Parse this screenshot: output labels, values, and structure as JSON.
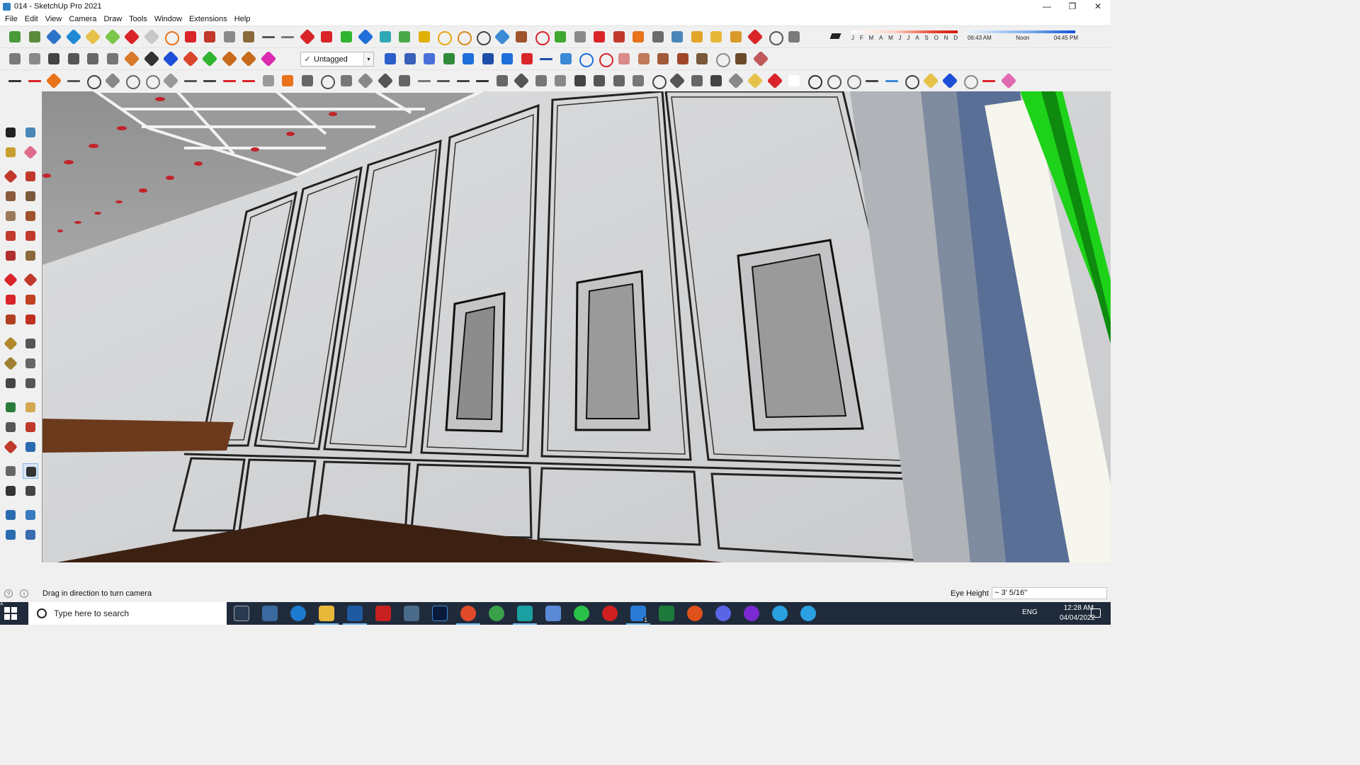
{
  "window": {
    "title": "014 - SketchUp Pro 2021",
    "minimize": "—",
    "maximize": "❐",
    "close": "✕"
  },
  "menu": [
    "File",
    "Edit",
    "View",
    "Camera",
    "Draw",
    "Tools",
    "Window",
    "Extensions",
    "Help"
  ],
  "toolbar": {
    "tag_dropdown": {
      "check": "✓",
      "value": "Untagged",
      "arrow": "▾"
    },
    "shadows": {
      "months": [
        "J",
        "F",
        "M",
        "A",
        "M",
        "J",
        "J",
        "A",
        "S",
        "O",
        "N",
        "D"
      ],
      "times": [
        "06:43 AM",
        "Noon",
        "04:45 PM"
      ]
    }
  },
  "status": {
    "hint": "Drag in direction to turn camera",
    "info_icons": [
      "?",
      "i"
    ],
    "vcb_label": "Eye Height",
    "vcb_value": "~ 3' 5/16\""
  },
  "taskbar": {
    "search_placeholder": "Type here to search",
    "language": "ENG",
    "time": "12:28 AM",
    "date": "04/04/2022",
    "badge": "1"
  },
  "colors": {
    "accent_orange": "#e8731a",
    "accent_red": "#d9252a",
    "accent_green": "#2fb530",
    "accent_blue": "#1e6fd9",
    "wall": "#d5d6d7",
    "floor_wood": "#3c2112",
    "shelf_wood": "#6b3a1d",
    "window_green": "#1ed21a"
  }
}
